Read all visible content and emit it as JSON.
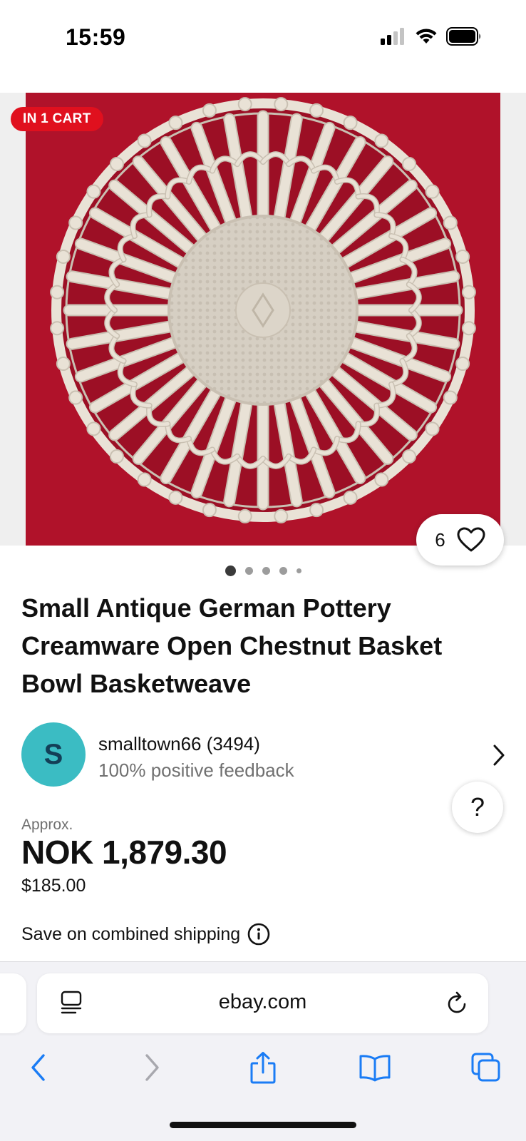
{
  "status_bar": {
    "time": "15:59",
    "icons": [
      "cellular-signal-icon",
      "wifi-icon",
      "battery-icon"
    ]
  },
  "listing": {
    "badge": "IN 1 CART",
    "watch_count": "6",
    "image_count": 5,
    "active_image_index": 0,
    "title": "Small Antique German Pottery Creamware Open Chestnut Basket Bowl Basketweave"
  },
  "seller": {
    "avatar_letter": "S",
    "name": "smalltown66 (3494)",
    "feedback": "100% positive feedback"
  },
  "help_label": "?",
  "price": {
    "approx_label": "Approx.",
    "local": "NOK 1,879.30",
    "usd": "$185.00"
  },
  "shipping": {
    "text": "Save on combined shipping"
  },
  "browser": {
    "address": "ebay.com",
    "toolbar_icons": [
      "back-icon",
      "forward-icon",
      "share-icon",
      "bookmarks-icon",
      "tabs-icon"
    ]
  },
  "colors": {
    "badge_red": "#e0101e",
    "avatar_teal": "#3bbcc3",
    "ios_blue": "#1a7cf5",
    "photo_background": "#b0122a"
  }
}
